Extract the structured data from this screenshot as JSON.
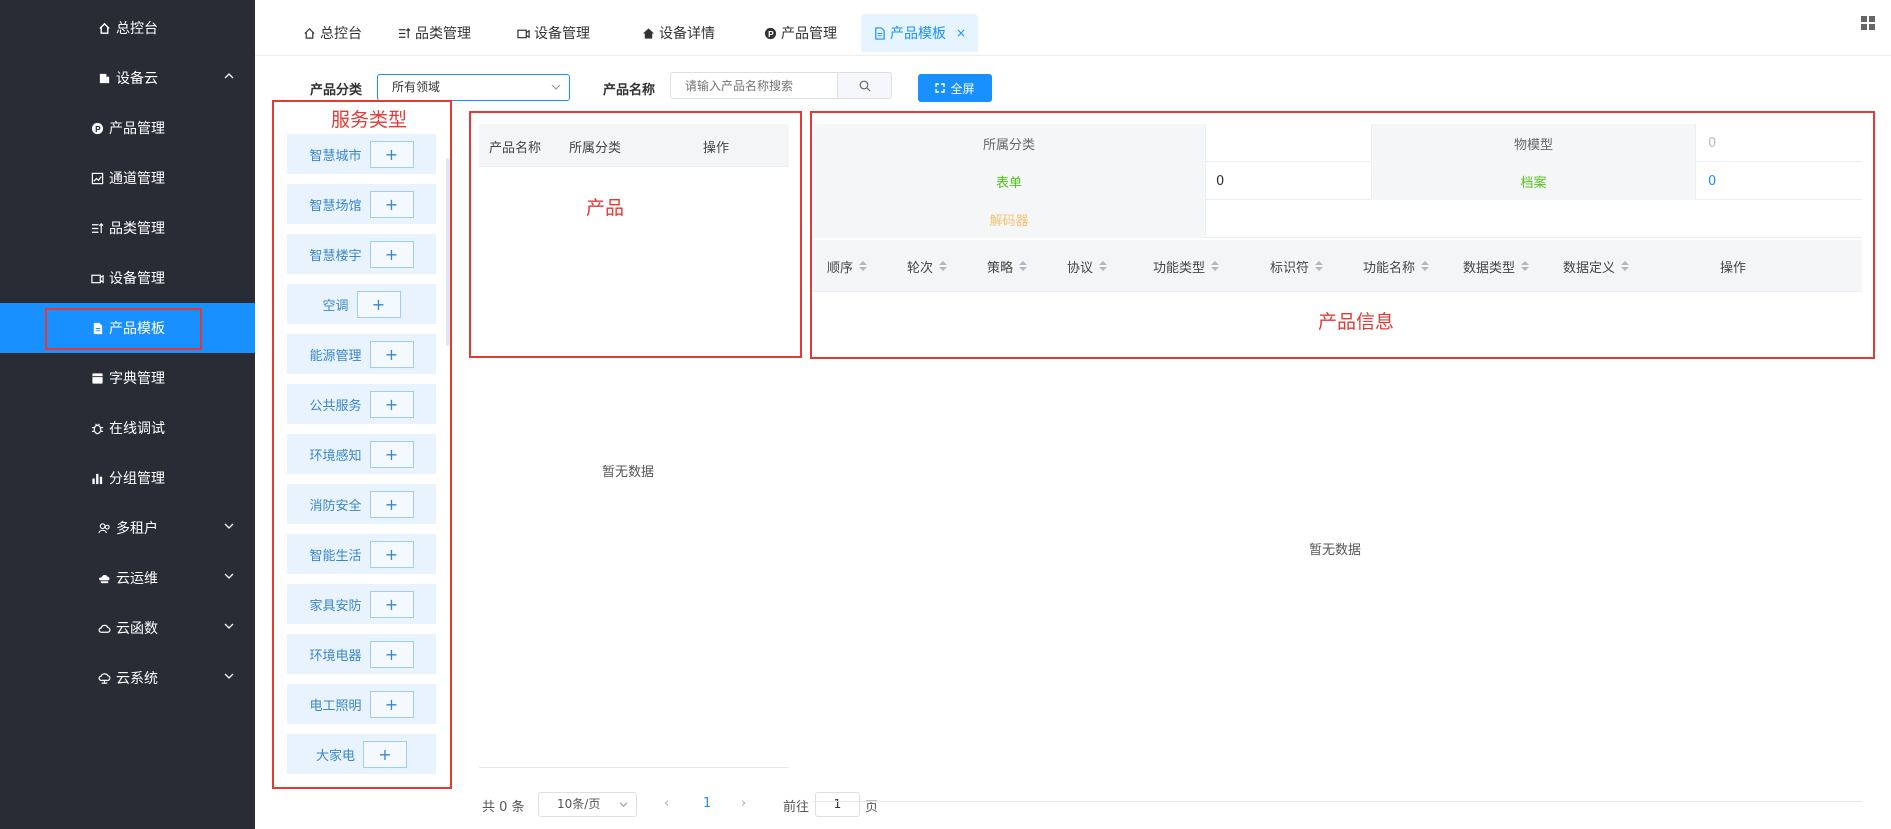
{
  "sidebar": {
    "items": [
      {
        "label": "总控台",
        "icon": "home-icon"
      },
      {
        "label": "设备云",
        "icon": "device-cloud-icon",
        "chevron": "up"
      },
      {
        "label": "产品管理",
        "icon": "product-p-icon"
      },
      {
        "label": "通道管理",
        "icon": "channel-icon"
      },
      {
        "label": "品类管理",
        "icon": "category-icon"
      },
      {
        "label": "设备管理",
        "icon": "video-device-icon"
      },
      {
        "label": "产品模板",
        "icon": "document-icon",
        "active": true
      },
      {
        "label": "字典管理",
        "icon": "dictionary-icon"
      },
      {
        "label": "在线调试",
        "icon": "bug-icon"
      },
      {
        "label": "分组管理",
        "icon": "bar-chart-icon"
      },
      {
        "label": "多租户",
        "icon": "users-icon",
        "chevron": "down"
      },
      {
        "label": "云运维",
        "icon": "cloud-ops-icon",
        "chevron": "down"
      },
      {
        "label": "云函数",
        "icon": "cloud-icon",
        "chevron": "down"
      },
      {
        "label": "云系统",
        "icon": "cloud-system-icon",
        "chevron": "down"
      }
    ]
  },
  "tabs": [
    {
      "label": "总控台",
      "icon": "home-icon"
    },
    {
      "label": "品类管理",
      "icon": "category-icon"
    },
    {
      "label": "设备管理",
      "icon": "video-device-icon"
    },
    {
      "label": "设备详情",
      "icon": "house-icon"
    },
    {
      "label": "产品管理",
      "icon": "product-p-icon"
    },
    {
      "label": "产品模板",
      "icon": "document-icon",
      "active": true,
      "close": "×"
    }
  ],
  "filters": {
    "category_label": "产品分类",
    "category_value": "所有领域",
    "name_label": "产品名称",
    "name_placeholder": "请输入产品名称搜索",
    "fullscreen_label": "全屏"
  },
  "annotations": {
    "service_type": "服务类型",
    "product": "产品",
    "product_info": "产品信息"
  },
  "service_types": [
    "智慧城市",
    "智慧场馆",
    "智慧楼宇",
    "空调",
    "能源管理",
    "公共服务",
    "环境感知",
    "消防安全",
    "智能生活",
    "家具安防",
    "环境电器",
    "电工照明",
    "大家电"
  ],
  "service_add_symbol": "+",
  "product_table": {
    "headers": [
      "产品名称",
      "所属分类",
      "操作"
    ],
    "empty_text": "暂无数据",
    "pagination": {
      "total": "共 0 条",
      "page_size": "10条/页",
      "prev": "‹",
      "current_page": "1",
      "next": "›",
      "goto_label": "前往",
      "goto_value": "1",
      "goto_suffix": "页"
    }
  },
  "info_table": {
    "row1": {
      "label1": "所属分类",
      "value1": "",
      "label2": "物模型",
      "value2": "0"
    },
    "row2": {
      "label1": "表单",
      "value1": "0",
      "label2": "档案",
      "value2": "0"
    },
    "row3": {
      "label1": "解码器",
      "value1": ""
    },
    "columns": [
      "顺序",
      "轮次",
      "策略",
      "协议",
      "功能类型",
      "标识符",
      "功能名称",
      "数据类型",
      "数据定义",
      "操作"
    ],
    "empty_text": "暂无数据"
  },
  "colors": {
    "sidebar_bg": "#272c35",
    "accent": "#1890ff",
    "annotation_red": "#e53935",
    "form_green": "#52c41a",
    "decoder_orange": "#f5c36b"
  }
}
